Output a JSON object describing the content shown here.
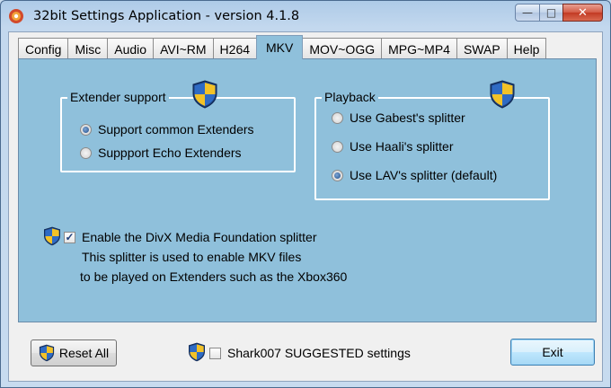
{
  "window": {
    "title": "32bit Settings Application - version 4.1.8"
  },
  "tabs": [
    "Config",
    "Misc",
    "Audio",
    "AVI~RM",
    "H264",
    "MKV",
    "MOV~OGG",
    "MPG~MP4",
    "SWAP",
    "Help"
  ],
  "active_tab": "MKV",
  "extender_support": {
    "title": "Extender support",
    "options": [
      {
        "label": "Support common Extenders",
        "selected": true
      },
      {
        "label": "Suppport Echo Extenders",
        "selected": false
      }
    ]
  },
  "playback": {
    "title": "Playback",
    "options": [
      {
        "label": "Use Gabest's splitter",
        "selected": false
      },
      {
        "label": "Use Haali's splitter",
        "selected": false
      },
      {
        "label": "Use LAV's splitter (default)",
        "selected": true
      }
    ]
  },
  "divx": {
    "checkbox_label": "Enable the DivX Media Foundation splitter",
    "checked": true,
    "description_line1": "This splitter is used to enable MKV files",
    "description_line2": "to be played on Extenders such as the Xbox360"
  },
  "footer": {
    "reset_label": "Reset All",
    "suggested_label": "Shark007 SUGGESTED settings",
    "suggested_checked": false,
    "exit_label": "Exit"
  },
  "icons": {
    "shield": "uac-shield-icon",
    "app": "app-icon"
  }
}
